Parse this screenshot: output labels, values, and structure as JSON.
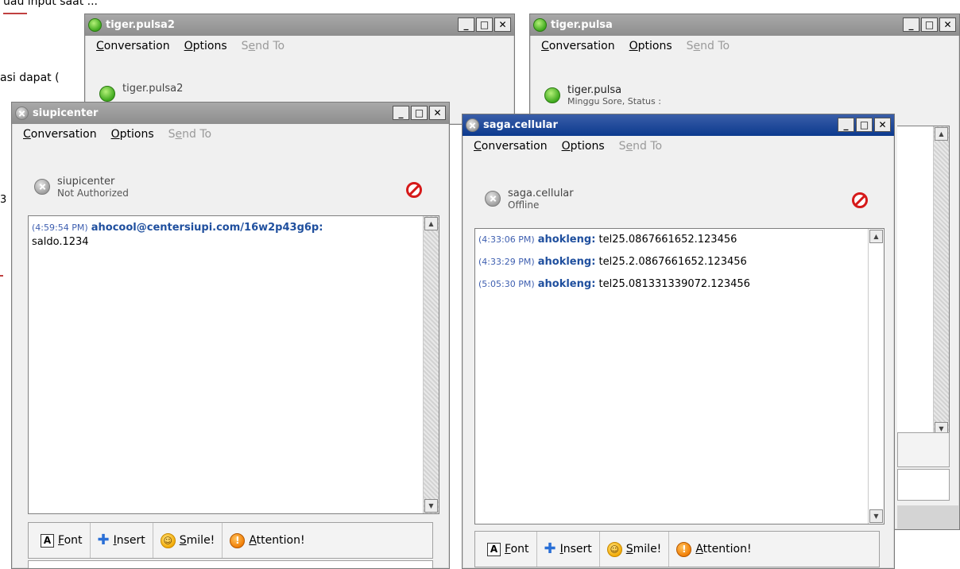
{
  "background_doc": {
    "fragment_top": "uau input saat ...",
    "fragment_mid": "asi dapat (",
    "fragment_side": "3"
  },
  "windows": {
    "tiger_pulsa2": {
      "title": "tiger.pulsa2",
      "contact_name": "tiger.pulsa2"
    },
    "tiger_pulsa": {
      "title": "tiger.pulsa",
      "contact_name": "tiger.pulsa",
      "contact_status": "Minggu Sore, Status :"
    },
    "siupicenter": {
      "title": "siupicenter",
      "contact_name": "siupicenter",
      "contact_status": "Not Authorized",
      "messages": [
        {
          "time": "(4:59:54 PM)",
          "sender": "ahocool@centersiupi.com/16w2p43g6p:",
          "text": "saldo.1234"
        }
      ]
    },
    "saga_cellular": {
      "title": "saga.cellular",
      "contact_name": "saga.cellular",
      "contact_status": "Offline",
      "messages": [
        {
          "time": "(4:33:06 PM)",
          "sender": "ahokleng:",
          "text": "tel25.0867661652.123456"
        },
        {
          "time": "(4:33:29 PM)",
          "sender": "ahokleng:",
          "text": "tel25.2.0867661652.123456"
        },
        {
          "time": "(5:05:30 PM)",
          "sender": "ahokleng:",
          "text": "tel25.081331339072.123456"
        }
      ]
    }
  },
  "menu": {
    "conversation_pre": "",
    "conversation_key": "C",
    "conversation_post": "onversation",
    "options_pre": "",
    "options_key": "O",
    "options_post": "ptions",
    "sendto_pre": "S",
    "sendto_key": "e",
    "sendto_post": "nd To"
  },
  "toolbar": {
    "font_key": "F",
    "font_post": "ont",
    "insert_key": "I",
    "insert_post": "nsert",
    "smile_key": "S",
    "smile_post": "mile!",
    "attention_key": "A",
    "attention_post": "ttention!",
    "font_icon_glyph": "A"
  },
  "controls": {
    "minimize": "_",
    "maximize": "□",
    "close": "✕"
  },
  "colors": {
    "active_title": "#0c3a8e",
    "inactive_title": "#8e8e8e",
    "sender": "#1f4f9e"
  }
}
